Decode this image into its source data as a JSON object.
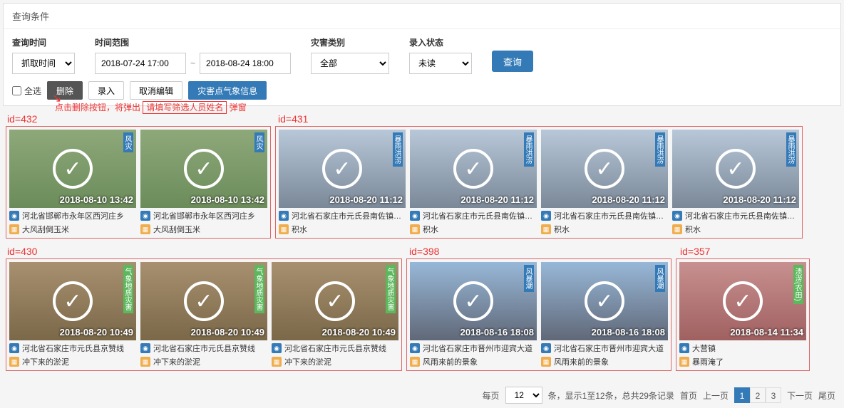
{
  "panel_title": "查询条件",
  "filters": {
    "time_label": "查询时间",
    "time_value": "抓取时间",
    "range_label": "时间范围",
    "range_start": "2018-07-24 17:00",
    "range_end": "2018-08-24 18:00",
    "disaster_label": "灾害类别",
    "disaster_value": "全部",
    "status_label": "录入状态",
    "status_value": "未读",
    "query_btn": "查询"
  },
  "actions": {
    "select_all": "全选",
    "delete": "删除",
    "enter": "录入",
    "cancel_edit": "取消编辑",
    "disaster_info": "灾害点气象信息"
  },
  "annotations": {
    "delete_hint": "点击删除按钮，将弹出",
    "popup_text": "请填写筛选人员姓名",
    "popup_suffix": "弹窗"
  },
  "groups": [
    {
      "id_label": "id=432",
      "cards": [
        {
          "cls": "thumb",
          "tag": "风灾",
          "ts": "2018-08-10 13:42",
          "loc": "河北省邯郸市永年区西河庄乡",
          "type": "大风刮倒玉米"
        },
        {
          "cls": "thumb",
          "tag": "风灾",
          "ts": "2018-08-10 13:42",
          "loc": "河北省邯郸市永年区西河庄乡",
          "type": "大风刮倒玉米"
        }
      ]
    },
    {
      "id_label": "id=431",
      "cards": [
        {
          "cls": "thumb urban",
          "tag": "暴雨洪涝",
          "ts": "2018-08-20 11:12",
          "loc": "河北省石家庄市元氏县南佐镇井元...",
          "type": "积水"
        },
        {
          "cls": "thumb urban",
          "tag": "暴雨洪涝",
          "ts": "2018-08-20 11:12",
          "loc": "河北省石家庄市元氏县南佐镇井元...",
          "type": "积水"
        },
        {
          "cls": "thumb urban",
          "tag": "暴雨洪涝",
          "ts": "2018-08-20 11:12",
          "loc": "河北省石家庄市元氏县南佐镇井元...",
          "type": "积水"
        },
        {
          "cls": "thumb urban",
          "tag": "暴雨洪涝",
          "ts": "2018-08-20 11:12",
          "loc": "河北省石家庄市元氏县南佐镇井元...",
          "type": "积水"
        }
      ]
    },
    {
      "id_label": "id=430",
      "cards": [
        {
          "cls": "thumb brown",
          "tag": "气象地质灾害",
          "tagcls": "green",
          "ts": "2018-08-20 10:49",
          "loc": "河北省石家庄市元氏县京赞线",
          "type": "冲下来的淤泥"
        },
        {
          "cls": "thumb brown",
          "tag": "气象地质灾害",
          "tagcls": "green",
          "ts": "2018-08-20 10:49",
          "loc": "河北省石家庄市元氏县京赞线",
          "type": "冲下来的淤泥"
        },
        {
          "cls": "thumb brown",
          "tag": "气象地质灾害",
          "tagcls": "green",
          "ts": "2018-08-20 10:49",
          "loc": "河北省石家庄市元氏县京赞线",
          "type": "冲下来的淤泥"
        }
      ]
    },
    {
      "id_label": "id=398",
      "cards": [
        {
          "cls": "thumb road",
          "tag": "风暴潮",
          "ts": "2018-08-16 18:08",
          "loc": "河北省石家庄市晋州市迎宾大道",
          "type": "风雨来前的景象"
        },
        {
          "cls": "thumb road",
          "tag": "风暴潮",
          "ts": "2018-08-16 18:08",
          "loc": "河北省石家庄市晋州市迎宾大道",
          "type": "风雨来前的景象"
        }
      ]
    },
    {
      "id_label": "id=357",
      "cards": [
        {
          "cls": "thumb flood",
          "tag": "渍涝(农田)",
          "tagcls": "green",
          "ts": "2018-08-14 11:34",
          "loc": "大营镇",
          "type": "暴雨淹了"
        }
      ]
    }
  ],
  "pager": {
    "per_page_label": "每页",
    "per_page_value": "12",
    "summary": "条，显示1至12条，总共29条记录",
    "first": "首页",
    "prev": "上一页",
    "pages": [
      "1",
      "2",
      "3"
    ],
    "next": "下一页",
    "last": "尾页"
  }
}
